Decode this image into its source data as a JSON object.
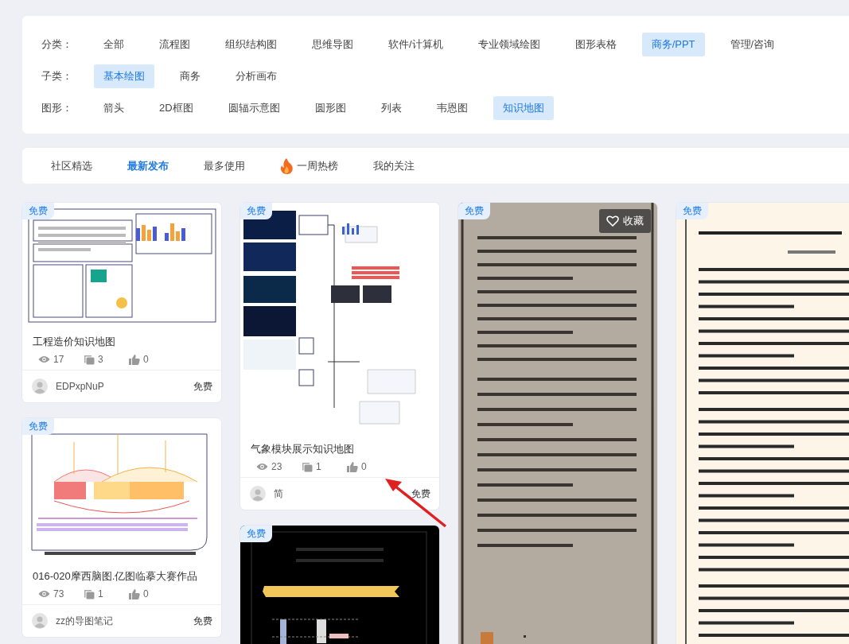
{
  "filters": [
    {
      "label": "分类：",
      "options": [
        {
          "label": "全部",
          "selected": false
        },
        {
          "label": "流程图",
          "selected": false
        },
        {
          "label": "组织结构图",
          "selected": false
        },
        {
          "label": "思维导图",
          "selected": false
        },
        {
          "label": "软件/计算机",
          "selected": false
        },
        {
          "label": "专业领域绘图",
          "selected": false
        },
        {
          "label": "图形表格",
          "selected": false
        },
        {
          "label": "商务/PPT",
          "selected": true
        },
        {
          "label": "管理/咨询",
          "selected": false
        }
      ]
    },
    {
      "label": "子类：",
      "options": [
        {
          "label": "基本绘图",
          "selected": true
        },
        {
          "label": "商务",
          "selected": false
        },
        {
          "label": "分析画布",
          "selected": false
        }
      ]
    },
    {
      "label": "图形：",
      "options": [
        {
          "label": "箭头",
          "selected": false
        },
        {
          "label": "2D框图",
          "selected": false
        },
        {
          "label": "圆辐示意图",
          "selected": false
        },
        {
          "label": "圆形图",
          "selected": false
        },
        {
          "label": "列表",
          "selected": false
        },
        {
          "label": "韦恩图",
          "selected": false
        },
        {
          "label": "知识地图",
          "selected": true
        }
      ]
    }
  ],
  "tabs": [
    {
      "label": "社区精选",
      "selected": false,
      "kind": "plain"
    },
    {
      "label": "最新发布",
      "selected": true,
      "kind": "plain"
    },
    {
      "label": "最多使用",
      "selected": false,
      "kind": "plain"
    },
    {
      "label": "一周热榜",
      "selected": false,
      "kind": "hot"
    },
    {
      "label": "我的关注",
      "selected": false,
      "kind": "plain"
    }
  ],
  "columns": [
    [
      {
        "kind": "full",
        "badge": "免费",
        "title": "工程造价知识地图",
        "stats": [
          {
            "kind": "views",
            "value": "17"
          },
          {
            "kind": "comments",
            "value": "3"
          },
          {
            "kind": "likes",
            "value": "0"
          }
        ],
        "author": "EDPxpNuP",
        "price": "免费"
      },
      {
        "kind": "full",
        "badge": "免费",
        "title": "016-020摩西脑图.亿图临摹大赛作品",
        "stats": [
          {
            "kind": "views",
            "value": "73"
          },
          {
            "kind": "comments",
            "value": "1"
          },
          {
            "kind": "likes",
            "value": "0"
          }
        ],
        "author": "zz的导图笔记",
        "price": "免费"
      }
    ],
    [
      {
        "kind": "full",
        "badge": "免费",
        "title": "气象模块展示知识地图",
        "stats": [
          {
            "kind": "views",
            "value": "23"
          },
          {
            "kind": "comments",
            "value": "1"
          },
          {
            "kind": "likes",
            "value": "0"
          }
        ],
        "author": "简",
        "price": "免费"
      },
      {
        "badge": "免费"
      }
    ],
    [
      {
        "badge": "免费",
        "favorite": "收藏"
      }
    ],
    [
      {
        "badge": "免费"
      }
    ]
  ]
}
